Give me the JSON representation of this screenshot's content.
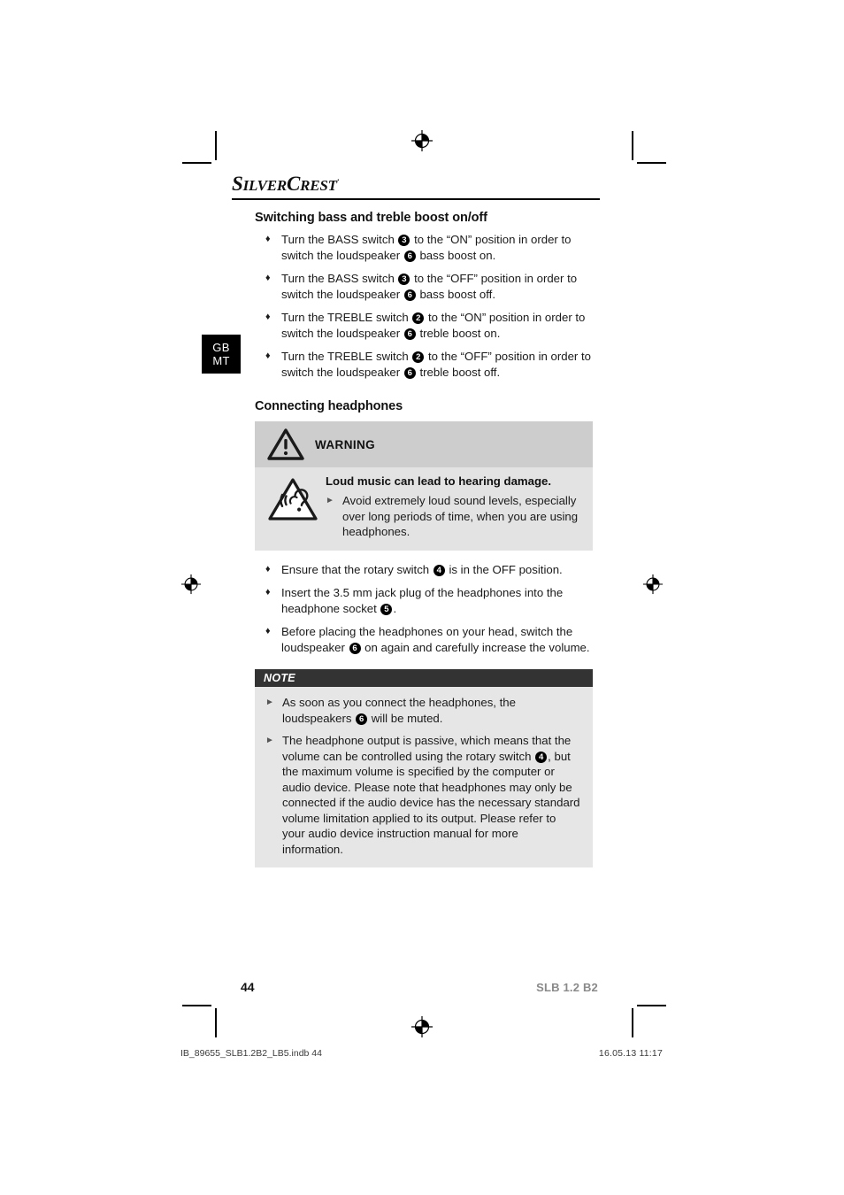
{
  "brand": {
    "name_part1": "S",
    "name_part2": "ILVER",
    "name_part3": "C",
    "name_part4": "REST",
    "superscript": "·"
  },
  "language_tab": {
    "line1": "GB",
    "line2": "MT"
  },
  "sections": [
    {
      "title": "Switching bass and treble boost on/off",
      "bullets": [
        {
          "marker": "♦",
          "parts": [
            {
              "t": "text",
              "v": "Turn the BASS switch "
            },
            {
              "t": "badge",
              "v": "3"
            },
            {
              "t": "text",
              "v": " to the “ON” position in order to switch the loudspeaker "
            },
            {
              "t": "badge",
              "v": "6"
            },
            {
              "t": "text",
              "v": " bass boost on."
            }
          ]
        },
        {
          "marker": "♦",
          "parts": [
            {
              "t": "text",
              "v": "Turn the BASS switch "
            },
            {
              "t": "badge",
              "v": "3"
            },
            {
              "t": "text",
              "v": " to the “OFF” position in order to switch the loudspeaker "
            },
            {
              "t": "badge",
              "v": "6"
            },
            {
              "t": "text",
              "v": " bass boost off."
            }
          ]
        },
        {
          "marker": "♦",
          "parts": [
            {
              "t": "text",
              "v": "Turn the TREBLE switch "
            },
            {
              "t": "badge",
              "v": "2"
            },
            {
              "t": "text",
              "v": " to the “ON” position in order to switch the loudspeaker "
            },
            {
              "t": "badge",
              "v": "6"
            },
            {
              "t": "text",
              "v": " treble boost on."
            }
          ]
        },
        {
          "marker": "♦",
          "parts": [
            {
              "t": "text",
              "v": "Turn the TREBLE switch "
            },
            {
              "t": "badge",
              "v": "2"
            },
            {
              "t": "text",
              "v": " to the “OFF” position in order to switch the loudspeaker "
            },
            {
              "t": "badge",
              "v": "6"
            },
            {
              "t": "text",
              "v": " treble boost off."
            }
          ]
        }
      ]
    },
    {
      "title": "Connecting headphones",
      "bullets": [
        {
          "marker": "♦",
          "parts": [
            {
              "t": "text",
              "v": "Ensure that the rotary switch "
            },
            {
              "t": "badge",
              "v": "4"
            },
            {
              "t": "text",
              "v": " is in the OFF position."
            }
          ]
        },
        {
          "marker": "♦",
          "parts": [
            {
              "t": "text",
              "v": "Insert the 3.5 mm jack plug of the headphones into the headphone socket "
            },
            {
              "t": "badge",
              "v": "5"
            },
            {
              "t": "text",
              "v": "."
            }
          ]
        },
        {
          "marker": "♦",
          "parts": [
            {
              "t": "text",
              "v": "Before placing the headphones on your head, switch the loudspeaker "
            },
            {
              "t": "badge",
              "v": "6"
            },
            {
              "t": "text",
              "v": " on again and carefully increase the volume."
            }
          ]
        }
      ]
    }
  ],
  "warning_box": {
    "header_label": "WARNING",
    "heading": "Loud music can lead to hearing damage.",
    "items": [
      {
        "marker": "►",
        "parts": [
          {
            "t": "text",
            "v": "Avoid extremely loud sound levels, especially over long periods of time, when you are using headphones."
          }
        ]
      }
    ],
    "header_bg": "#cdcdcd",
    "body_bg": "#e3e3e3"
  },
  "note_box": {
    "header_label": "NOTE",
    "items": [
      {
        "marker": "►",
        "parts": [
          {
            "t": "text",
            "v": "As soon as you connect the headphones, the loudspeakers "
          },
          {
            "t": "badge",
            "v": "6"
          },
          {
            "t": "text",
            "v": " will be muted."
          }
        ]
      },
      {
        "marker": "►",
        "parts": [
          {
            "t": "text",
            "v": "The headphone output is passive, which means that the volume can be controlled using the rotary switch "
          },
          {
            "t": "badge",
            "v": "4"
          },
          {
            "t": "text",
            "v": ", but the maximum volume is specified by the computer or audio device. Please note that headphones may only be connected if the audio device has the necessary standard volume limitation applied to its output. Please refer to your audio device instruction manual for more information."
          }
        ]
      }
    ],
    "header_bg": "#333333",
    "body_bg": "#e6e6e6"
  },
  "footer": {
    "page_number": "44",
    "model": "SLB 1.2 B2"
  },
  "print_footer": {
    "file": "IB_89655_SLB1.2B2_LB5.indb   44",
    "datetime": "16.05.13   11:17"
  },
  "icons": {
    "warning_triangle": "warning-triangle-icon",
    "hearing_damage": "hearing-damage-icon",
    "registration_mark": "registration-mark-icon",
    "crop_mark": "crop-mark-icon"
  }
}
